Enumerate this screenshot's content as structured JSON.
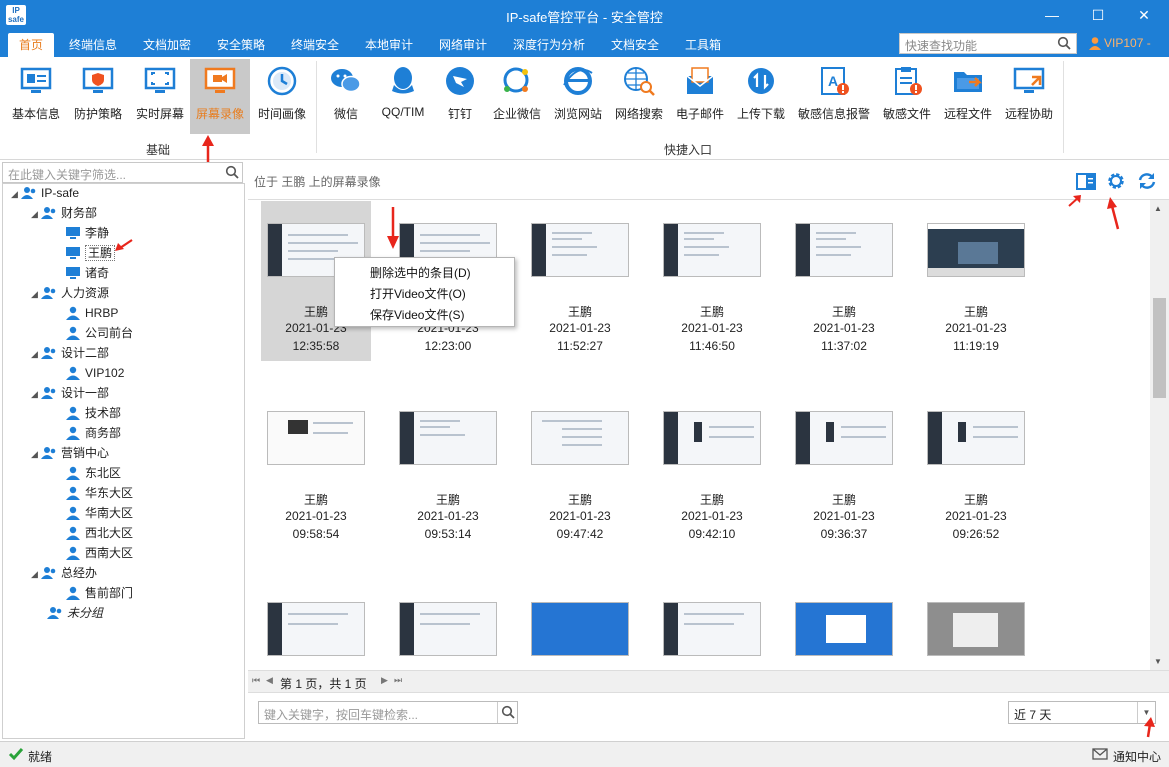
{
  "window": {
    "logo_text": "IP safe",
    "title": "IP-safe管控平台 - 安全管控",
    "minimize": "—",
    "maximize": "☐",
    "close": "✕"
  },
  "menu": {
    "tabs": [
      "首页",
      "终端信息",
      "文档加密",
      "安全策略",
      "终端安全",
      "本地审计",
      "网络审计",
      "深度行为分析",
      "文档安全",
      "工具箱"
    ],
    "active_tab": "首页",
    "quick_search_placeholder": "快速查找功能",
    "user": "VIP107 -"
  },
  "ribbon": {
    "basic_group_label": "基础",
    "quick_group_label": "快捷入口",
    "basic": [
      "基本信息",
      "防护策略",
      "实时屏幕",
      "屏幕录像",
      "时间画像"
    ],
    "selected": "屏幕录像",
    "quick": [
      "微信",
      "QQ/TIM",
      "钉钉",
      "企业微信",
      "浏览网站",
      "网络搜索",
      "电子邮件",
      "上传下载",
      "敏感信息报警",
      "敏感文件",
      "远程文件",
      "远程协助"
    ]
  },
  "tree": {
    "filter_placeholder": "在此键入关键字筛选...",
    "nodes": [
      "IP-safe",
      "财务部",
      "李静",
      "王鹏",
      "诸奇",
      "人力资源",
      "HRBP",
      "公司前台",
      "设计二部",
      "VIP102",
      "设计一部",
      "技术部",
      "商务部",
      "营销中心",
      "东北区",
      "华东大区",
      "华南大区",
      "西北大区",
      "西南大区",
      "总经办",
      "售前部门",
      "未分组"
    ],
    "selected": "王鹏"
  },
  "content": {
    "breadcrumb": "位于 王鹏 上的屏幕录像",
    "recordings": [
      {
        "name": "王鹏",
        "date": "2021-01-23",
        "time": "12:35:58"
      },
      {
        "name": "王鹏",
        "date": "2021-01-23",
        "time": "12:23:00"
      },
      {
        "name": "王鹏",
        "date": "2021-01-23",
        "time": "11:52:27"
      },
      {
        "name": "王鹏",
        "date": "2021-01-23",
        "time": "11:46:50"
      },
      {
        "name": "王鹏",
        "date": "2021-01-23",
        "time": "11:37:02"
      },
      {
        "name": "王鹏",
        "date": "2021-01-23",
        "time": "11:19:19"
      },
      {
        "name": "王鹏",
        "date": "2021-01-23",
        "time": "09:58:54"
      },
      {
        "name": "王鹏",
        "date": "2021-01-23",
        "time": "09:53:14"
      },
      {
        "name": "王鹏",
        "date": "2021-01-23",
        "time": "09:47:42"
      },
      {
        "name": "王鹏",
        "date": "2021-01-23",
        "time": "09:42:10"
      },
      {
        "name": "王鹏",
        "date": "2021-01-23",
        "time": "09:36:37"
      },
      {
        "name": "王鹏",
        "date": "2021-01-23",
        "time": "09:26:52"
      }
    ],
    "pager_text": "第 1 页，共 1 页",
    "keyword_placeholder": "键入关键字，按回车键检索...",
    "range_value": "近 7 天"
  },
  "context_menu": {
    "items": [
      "删除选中的条目(D)",
      "打开Video文件(O)",
      "保存Video文件(S)"
    ]
  },
  "status": {
    "text": "就绪",
    "notify": "通知中心"
  },
  "colors": {
    "title_bar": "#1e7fd6",
    "accent_orange": "#e87d1e",
    "icon_blue": "#1e7fd6",
    "annotation_red": "#e8261c"
  }
}
